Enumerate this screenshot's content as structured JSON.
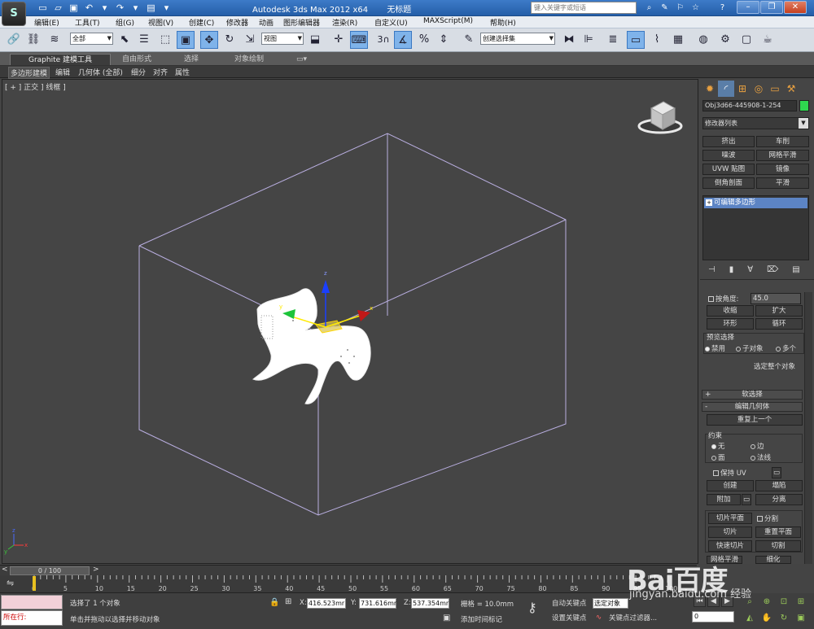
{
  "app": {
    "logo_text": "S",
    "title": "Autodesk 3ds Max  2012 x64",
    "document_title": "无标题",
    "search_placeholder": "键入关键字或短语"
  },
  "menu": [
    "编辑(E)",
    "工具(T)",
    "组(G)",
    "视图(V)",
    "创建(C)",
    "修改器",
    "动画",
    "图形编辑器",
    "渲染(R)",
    "自定义(U)",
    "MAXScript(M)",
    "帮助(H)"
  ],
  "toolbar": {
    "selection_filter": "全部",
    "ref_coord": "视图",
    "named_selection": "创建选择集",
    "snap_label": "3"
  },
  "ribbon": {
    "tabs": [
      "Graphite 建模工具",
      "自由形式",
      "选择",
      "对象绘制"
    ],
    "subtabs": [
      "多边形建模",
      "编辑",
      "几何体 (全部)",
      "细分",
      "对齐",
      "属性"
    ]
  },
  "viewport": {
    "label": "[ + ] 正交 ] 线框 ]"
  },
  "command_panel": {
    "object_name": "Obj3d66-445908-1-254",
    "object_color": "#2fd64f",
    "modifier_list": "修改器列表",
    "modifier_buttons": [
      "挤出",
      "车削",
      "噪波",
      "网格平滑",
      "UVW 贴图",
      "镜像",
      "倒角剖面",
      "平滑"
    ],
    "stack_item": "可编辑多边形",
    "selection": {
      "by_angle_label": "按角度:",
      "by_angle_value": "45.0",
      "shrink": "收缩",
      "grow": "扩大",
      "ring": "环形",
      "loop": "循环",
      "preview_label": "预览选择",
      "preview_options": [
        "禁用",
        "子对象",
        "多个"
      ],
      "select_whole": "选定整个对象"
    },
    "soft_selection": "软选择",
    "edit_geometry": "编辑几何体",
    "repeat_last": "重复上一个",
    "constraints_label": "约束",
    "constraints": [
      "无",
      "边",
      "面",
      "法线"
    ],
    "preserve_uv": "保持 UV",
    "create": "创建",
    "collapse": "塌陷",
    "attach": "附加",
    "detach": "分离",
    "slice_plane": "切片平面",
    "split": "分割",
    "slice": "切片",
    "reset_plane": "重置平面",
    "quickslice": "快速切片",
    "cut": "切割",
    "msmooth": "网格平滑",
    "tessellate": "细化"
  },
  "timeline": {
    "position": "0 / 100",
    "frame_ticks": [
      "0",
      "5",
      "10",
      "15",
      "20",
      "25",
      "30",
      "35",
      "40",
      "45",
      "50",
      "55",
      "60",
      "65",
      "70",
      "75",
      "80",
      "85",
      "90",
      "95",
      "100"
    ]
  },
  "status": {
    "maxscript_label": "所在行:",
    "selection_msg": "选择了 1 个对象",
    "hint_msg": "单击并拖动以选择并移动对象",
    "x_label": "X:",
    "x_value": "416.523mr",
    "y_label": "Y:",
    "y_value": "731.616mr",
    "z_label": "Z:",
    "z_value": "537.354mr",
    "grid": "栅格 = 10.0mm",
    "add_time_tag": "添加时间标记",
    "auto_key": "自动关键点",
    "set_key": "设置关键点",
    "selected_dropdown": "选定对象",
    "key_filters": "关键点过滤器...",
    "current_frame": "0"
  },
  "watermark": {
    "brand": "Bai百度",
    "sub": "jingyan.baidu.com",
    "experience": "经验"
  }
}
